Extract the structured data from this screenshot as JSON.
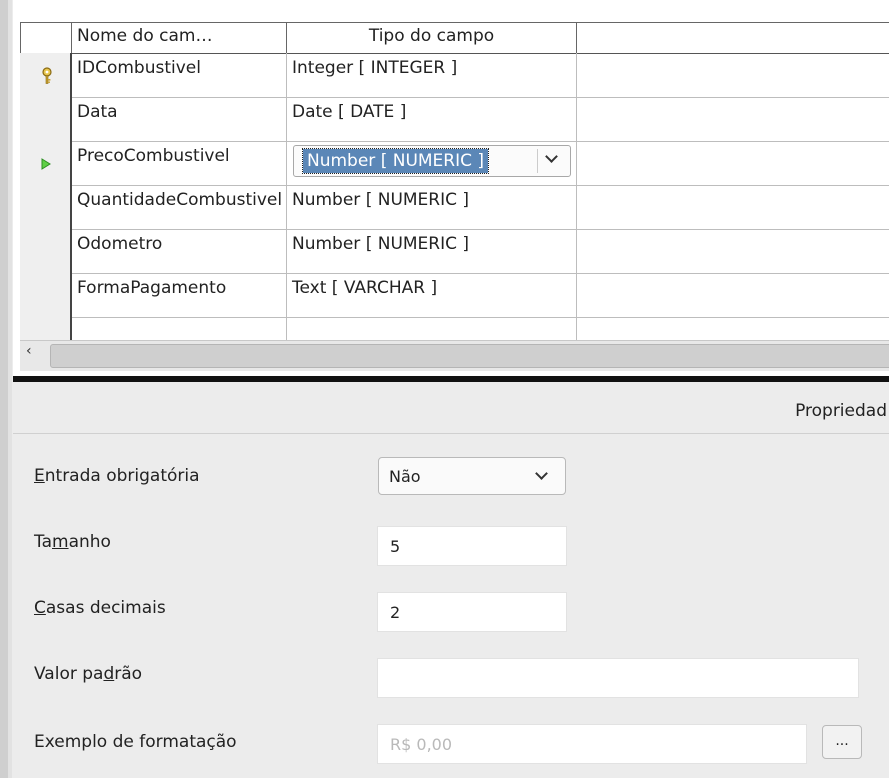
{
  "table": {
    "headers": {
      "name": "Nome do cam…",
      "type": "Tipo do campo"
    },
    "rows": [
      {
        "name": "IDCombustivel",
        "type": "Integer [ INTEGER ]",
        "marker": "key"
      },
      {
        "name": "Data",
        "type": "Date [ DATE ]",
        "marker": ""
      },
      {
        "name": "PrecoCombustivel",
        "type": "Number [ NUMERIC ]",
        "marker": "current"
      },
      {
        "name": "QuantidadeCombustivel",
        "type": "Number [ NUMERIC ]",
        "marker": ""
      },
      {
        "name": "Odometro",
        "type": "Number [ NUMERIC ]",
        "marker": ""
      },
      {
        "name": "FormaPagamento",
        "type": "Text [ VARCHAR ]",
        "marker": ""
      }
    ],
    "selected_type": "Number [ NUMERIC ]"
  },
  "properties": {
    "title": "Propriedad",
    "entrada_obrigatoria": {
      "label_u": "E",
      "label_rest": "ntrada obrigatória",
      "value": "Não"
    },
    "tamanho": {
      "label_pre": "Ta",
      "label_u": "m",
      "label_post": "anho",
      "value": "5"
    },
    "casas_decimais": {
      "label_u": "C",
      "label_rest": "asas decimais",
      "value": "2"
    },
    "valor_padrao": {
      "label_pre": "Valor pa",
      "label_u": "d",
      "label_post": "rão",
      "value": ""
    },
    "exemplo_formatacao": {
      "label": "Exemplo de formatação",
      "value": "R$ 0,00",
      "button_label": "..."
    }
  },
  "icons": {
    "primary_key": "key-icon",
    "current_row": "play-arrow-icon",
    "scroll_left": "scroll-left-icon",
    "dropdown": "chevron-down-icon"
  },
  "colors": {
    "selection": "#5b87b7",
    "play_arrow": "#3aa531",
    "key": "#d4a72c"
  }
}
